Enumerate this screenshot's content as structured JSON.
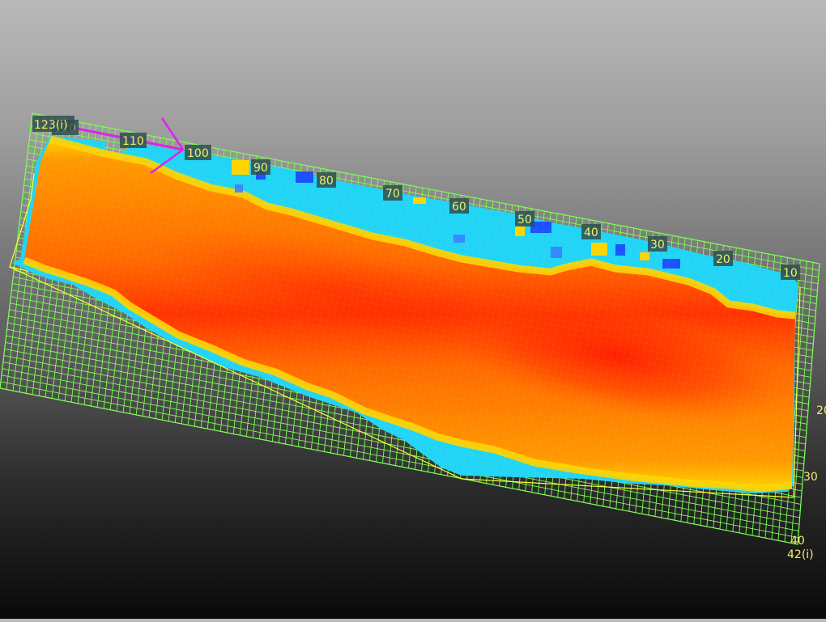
{
  "viewer": {
    "colors": {
      "background_top": "#b9b9b9",
      "background_bottom": "#090909",
      "grid": "#7cff55",
      "outline": "#ffff33",
      "arrow": "#dd22ee",
      "label_text": "#f4ef6a",
      "label_bg": "#2f4f4f"
    },
    "colormap": {
      "low": "#1a3cff",
      "cool": "#22d4f5",
      "mid": "#ffd400",
      "warm": "#ff7a00",
      "high": "#ff2200"
    },
    "i_axis": {
      "corner_label": "123(i)",
      "ticks": [
        "120",
        "110",
        "100",
        "90",
        "80",
        "70",
        "60",
        "50",
        "40",
        "30",
        "20",
        "10"
      ]
    },
    "j_axis": {
      "ticks": [
        "20",
        "30",
        "40"
      ],
      "corner_label": "42(i)"
    },
    "direction_arrow": "direction-arrow"
  }
}
